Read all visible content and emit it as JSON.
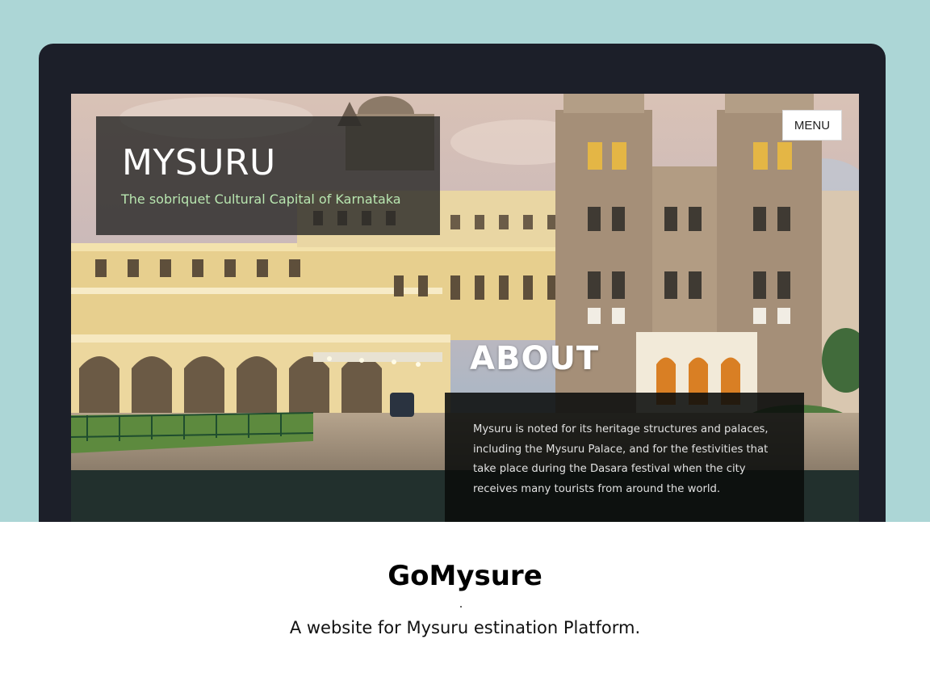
{
  "hero": {
    "title": "MYSURU",
    "subtitle": "The sobriquet Cultural Capital of Karnataka"
  },
  "nav": {
    "menu_label": "MENU"
  },
  "about": {
    "title": "ABOUT",
    "text": "Mysuru is noted for its heritage structures and palaces, including the Mysuru Palace, and for the festivities that take place during the Dasara festival when the city receives many tourists from around the world."
  },
  "caption": {
    "title": "GoMysure",
    "subtitle": "A website for Mysuru estination Platform."
  },
  "colors": {
    "background_top": "#acd6d6",
    "device_frame": "#1c1f29",
    "hero_subtitle": "#b8e6b0"
  }
}
